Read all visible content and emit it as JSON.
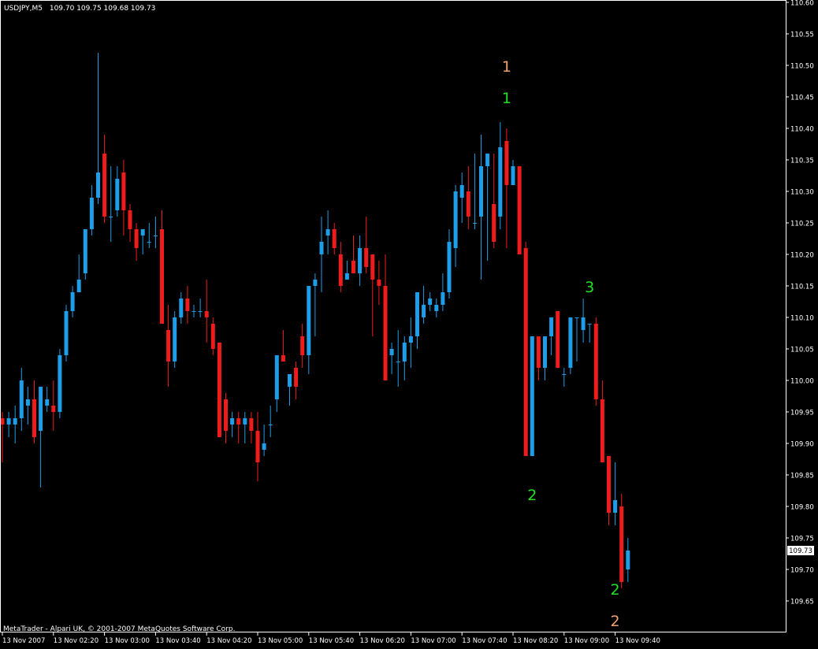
{
  "header": {
    "symbol_label": "USDJPY,M5",
    "ohlc_label": "109.70 109.75 109.68 109.73"
  },
  "footer": {
    "copyright": "MetaTrader - Alpari UK, © 2001-2007 MetaQuotes Software Corp."
  },
  "current_price_label": "109.73",
  "colors": {
    "background": "#000000",
    "axis": "#ffffff",
    "bull": "#1e9ee8",
    "bear": "#ee1c1c",
    "wave_green": "#22e022",
    "wave_orange": "#f2a070"
  },
  "chart_data": {
    "type": "candlestick",
    "ylim": [
      109.605,
      110.6
    ],
    "y_ticks": [
      "110.60",
      "110.55",
      "110.50",
      "110.45",
      "110.40",
      "110.35",
      "110.30",
      "110.25",
      "110.20",
      "110.15",
      "110.10",
      "110.05",
      "110.00",
      "109.95",
      "109.90",
      "109.85",
      "109.80",
      "109.75",
      "109.70",
      "109.65"
    ],
    "x_ticks": [
      "13 Nov 2007",
      "13 Nov 02:20",
      "13 Nov 03:00",
      "13 Nov 03:40",
      "13 Nov 04:20",
      "13 Nov 05:00",
      "13 Nov 05:40",
      "13 Nov 06:20",
      "13 Nov 07:00",
      "13 Nov 07:40",
      "13 Nov 08:20",
      "13 Nov 09:00",
      "13 Nov 09:40"
    ],
    "x_tick_bar_index": [
      0,
      8,
      16,
      24,
      32,
      40,
      48,
      56,
      64,
      72,
      80,
      88,
      96
    ],
    "candles": [
      [
        109.94,
        109.95,
        109.87,
        109.93
      ],
      [
        109.93,
        109.95,
        109.91,
        109.94
      ],
      [
        109.93,
        109.96,
        109.9,
        109.94
      ],
      [
        109.94,
        110.02,
        109.92,
        110.0
      ],
      [
        109.96,
        109.99,
        109.93,
        109.97
      ],
      [
        109.97,
        110.0,
        109.9,
        109.91
      ],
      [
        109.92,
        109.98,
        109.83,
        109.99
      ],
      [
        109.96,
        109.99,
        109.95,
        109.97
      ],
      [
        109.96,
        110.0,
        109.92,
        109.95
      ],
      [
        109.95,
        110.05,
        109.94,
        110.04
      ],
      [
        110.04,
        110.12,
        110.03,
        110.11
      ],
      [
        110.11,
        110.15,
        110.1,
        110.14
      ],
      [
        110.14,
        110.2,
        110.14,
        110.16
      ],
      [
        110.17,
        110.21,
        110.16,
        110.24
      ],
      [
        110.24,
        110.31,
        110.23,
        110.29
      ],
      [
        110.29,
        110.52,
        110.28,
        110.33
      ],
      [
        110.36,
        110.39,
        110.25,
        110.26
      ],
      [
        110.26,
        110.34,
        110.22,
        110.26
      ],
      [
        110.27,
        110.34,
        110.26,
        110.32
      ],
      [
        110.33,
        110.35,
        110.23,
        110.27
      ],
      [
        110.27,
        110.28,
        110.22,
        110.24
      ],
      [
        110.24,
        110.25,
        110.19,
        110.21
      ],
      [
        110.23,
        110.24,
        110.2,
        110.24
      ],
      [
        110.22,
        110.25,
        110.21,
        110.22
      ],
      [
        110.23,
        110.26,
        110.21,
        110.23
      ],
      [
        110.24,
        110.27,
        110.09,
        110.09
      ],
      [
        110.08,
        110.12,
        109.99,
        110.03
      ],
      [
        110.03,
        110.11,
        110.02,
        110.1
      ],
      [
        110.1,
        110.14,
        110.09,
        110.13
      ],
      [
        110.13,
        110.15,
        110.09,
        110.11
      ],
      [
        110.11,
        110.12,
        110.1,
        110.11
      ],
      [
        110.11,
        110.13,
        110.1,
        110.11
      ],
      [
        110.11,
        110.16,
        110.06,
        110.1
      ],
      [
        110.09,
        110.1,
        110.04,
        110.05
      ],
      [
        110.06,
        110.06,
        109.92,
        109.91
      ],
      [
        109.97,
        109.98,
        109.9,
        109.92
      ],
      [
        109.93,
        109.95,
        109.91,
        109.94
      ],
      [
        109.94,
        109.95,
        109.9,
        109.93
      ],
      [
        109.93,
        109.95,
        109.9,
        109.94
      ],
      [
        109.94,
        109.95,
        109.9,
        109.92
      ],
      [
        109.92,
        109.95,
        109.84,
        109.87
      ],
      [
        109.89,
        109.93,
        109.88,
        109.9
      ],
      [
        109.93,
        109.96,
        109.91,
        109.93
      ],
      [
        109.97,
        110.02,
        109.95,
        110.04
      ],
      [
        110.04,
        110.08,
        110.03,
        110.03
      ],
      [
        109.99,
        110.01,
        109.96,
        110.01
      ],
      [
        110.02,
        110.03,
        109.97,
        109.99
      ],
      [
        110.07,
        110.09,
        110.02,
        110.04
      ],
      [
        110.04,
        110.12,
        110.01,
        110.15
      ],
      [
        110.15,
        110.17,
        110.07,
        110.16
      ],
      [
        110.2,
        110.26,
        110.14,
        110.22
      ],
      [
        110.23,
        110.27,
        110.2,
        110.24
      ],
      [
        110.24,
        110.25,
        110.2,
        110.21
      ],
      [
        110.2,
        110.22,
        110.14,
        110.15
      ],
      [
        110.16,
        110.19,
        110.16,
        110.17
      ],
      [
        110.19,
        110.23,
        110.18,
        110.17
      ],
      [
        110.17,
        110.23,
        110.15,
        110.21
      ],
      [
        110.21,
        110.26,
        110.17,
        110.18
      ],
      [
        110.2,
        110.2,
        110.07,
        110.16
      ],
      [
        110.16,
        110.19,
        110.12,
        110.15
      ],
      [
        110.15,
        110.2,
        110.0,
        110.0
      ],
      [
        110.04,
        110.06,
        110.01,
        110.05
      ],
      [
        110.03,
        110.08,
        109.99,
        110.03
      ],
      [
        110.03,
        110.07,
        110.0,
        110.06
      ],
      [
        110.06,
        110.1,
        110.02,
        110.07
      ],
      [
        110.07,
        110.14,
        110.05,
        110.14
      ],
      [
        110.1,
        110.15,
        110.09,
        110.12
      ],
      [
        110.12,
        110.14,
        110.11,
        110.13
      ],
      [
        110.11,
        110.13,
        110.1,
        110.12
      ],
      [
        110.12,
        110.17,
        110.11,
        110.14
      ],
      [
        110.14,
        110.24,
        110.13,
        110.22
      ],
      [
        110.21,
        110.31,
        110.18,
        110.3
      ],
      [
        110.29,
        110.33,
        110.25,
        110.31
      ],
      [
        110.3,
        110.34,
        110.24,
        110.26
      ],
      [
        110.25,
        110.36,
        110.24,
        110.25
      ],
      [
        110.26,
        110.39,
        110.16,
        110.34
      ],
      [
        110.34,
        110.36,
        110.19,
        110.36
      ],
      [
        110.28,
        110.36,
        110.21,
        110.22
      ],
      [
        110.26,
        110.41,
        110.24,
        110.37
      ],
      [
        110.38,
        110.4,
        110.21,
        110.31
      ],
      [
        110.31,
        110.35,
        110.31,
        110.34
      ],
      [
        110.34,
        110.34,
        110.2,
        110.2
      ],
      [
        110.21,
        110.22,
        109.88,
        109.88
      ],
      [
        109.88,
        110.04,
        109.88,
        110.07
      ],
      [
        110.07,
        110.07,
        110.0,
        110.02
      ],
      [
        110.02,
        110.05,
        110.0,
        110.07
      ],
      [
        110.07,
        110.1,
        110.04,
        110.1
      ],
      [
        110.11,
        110.11,
        110.02,
        110.02
      ],
      [
        110.01,
        110.02,
        109.99,
        110.01
      ],
      [
        110.02,
        110.1,
        110.01,
        110.1
      ],
      [
        110.1,
        110.1,
        110.03,
        110.1
      ],
      [
        110.08,
        110.13,
        110.06,
        110.1
      ],
      [
        110.09,
        110.09,
        110.06,
        110.09
      ],
      [
        110.09,
        110.1,
        109.96,
        109.97
      ],
      [
        109.97,
        110.0,
        109.87,
        109.87
      ],
      [
        109.88,
        109.88,
        109.77,
        109.79
      ],
      [
        109.79,
        109.87,
        109.77,
        109.81
      ],
      [
        109.8,
        109.82,
        109.67,
        109.68
      ],
      [
        109.7,
        109.75,
        109.68,
        109.73
      ]
    ],
    "annotations": [
      {
        "text": "1",
        "bar": 79,
        "price": 110.49,
        "color": "orange"
      },
      {
        "text": "1",
        "bar": 79,
        "price": 110.44,
        "color": "green"
      },
      {
        "text": "2",
        "bar": 83,
        "price": 109.81,
        "color": "green"
      },
      {
        "text": "3",
        "bar": 92,
        "price": 110.14,
        "color": "green"
      },
      {
        "text": "2",
        "bar": 96,
        "price": 109.66,
        "color": "green"
      },
      {
        "text": "2",
        "bar": 96,
        "price": 109.61,
        "color": "orange"
      }
    ]
  }
}
